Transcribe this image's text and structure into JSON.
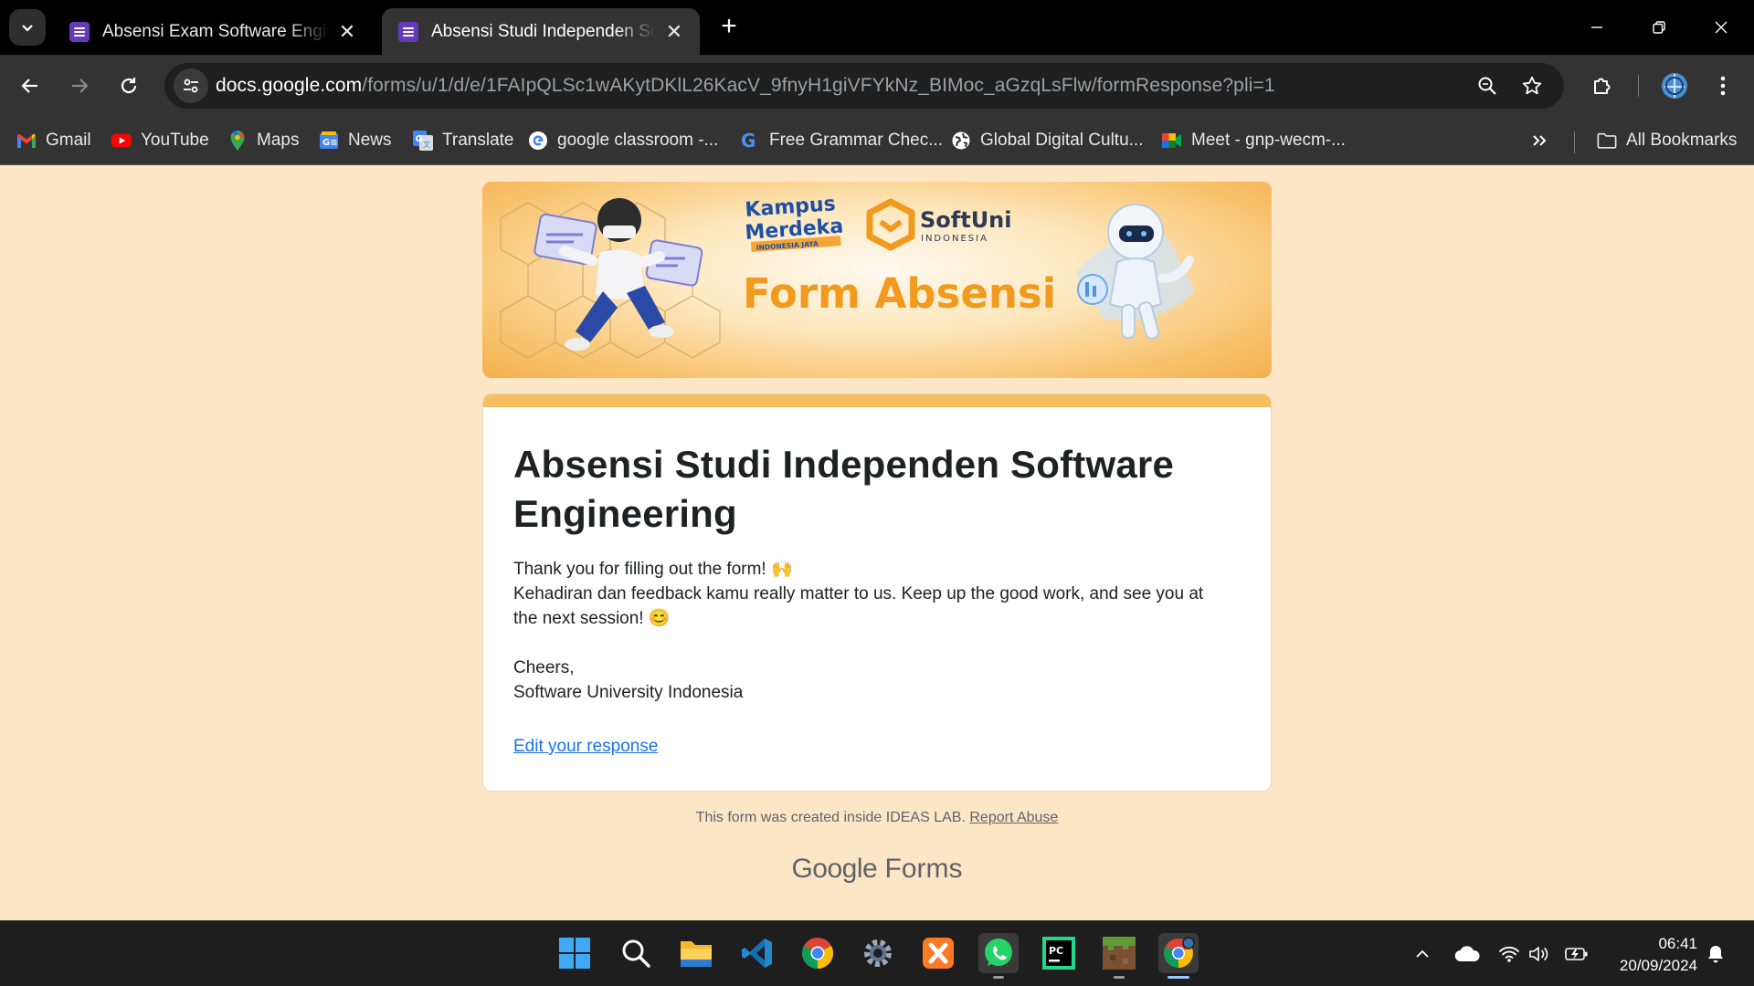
{
  "tabs": [
    {
      "title": "Absensi Exam Software Engineering",
      "active": false
    },
    {
      "title": "Absensi Studi Independen Software Engineering",
      "active": true
    }
  ],
  "new_tab_symbol": "+",
  "address_bar": {
    "host": "docs.google.com",
    "path": "/forms/u/1/d/e/1FAIpQLSc1wAKytDKlL26KacV_9fnyH1giVFYkNz_BIMoc_aGzqLsFlw/formResponse?pli=1"
  },
  "bookmarks": [
    {
      "label": "Gmail",
      "icon": "gmail-icon"
    },
    {
      "label": "YouTube",
      "icon": "youtube-icon"
    },
    {
      "label": "Maps",
      "icon": "maps-icon"
    },
    {
      "label": "News",
      "icon": "news-icon"
    },
    {
      "label": "Translate",
      "icon": "translate-icon"
    },
    {
      "label": "google classroom -...",
      "icon": "google-icon"
    },
    {
      "label": "Free Grammar Chec...",
      "icon": "grammar-icon"
    },
    {
      "label": "Global Digital Cultu...",
      "icon": "globe-icon"
    },
    {
      "label": "Meet - gnp-wecm-...",
      "icon": "meet-icon"
    }
  ],
  "all_bookmarks_label": "All Bookmarks",
  "banner": {
    "brand_line1": "Kampus",
    "brand_line2": "Merdeka",
    "brand_sub": "INDONESIA JAYA",
    "partner": "SoftUni",
    "partner_sub": "INDONESIA",
    "heading": "Form Absensi"
  },
  "form": {
    "title": "Absensi Studi Independen Software Engineering",
    "message_lines": [
      "Thank you for filling out the form! 🙌",
      "Kehadiran dan feedback kamu really matter to us. Keep up the good work, and see you at",
      "the next session! 😊",
      "",
      "Cheers,",
      "Software University Indonesia"
    ],
    "edit_link": "Edit your response"
  },
  "footer": {
    "note": "This form was created inside IDEAS LAB.",
    "report": "Report Abuse",
    "logo_google": "Google",
    "logo_forms": "Forms"
  },
  "taskbar": {
    "apps": [
      "start-icon",
      "search-icon",
      "file-explorer-icon",
      "vscode-icon",
      "chrome-icon",
      "settings-icon",
      "xampp-icon",
      "whatsapp-icon",
      "pycharm-icon",
      "minecraft-icon",
      "chrome-profile-icon"
    ],
    "time": "06:41",
    "date": "20/09/2024"
  },
  "colors": {
    "page_bg": "#fde6c6",
    "accent": "#f6be5e",
    "link": "#1a73e8",
    "forms_purple": "#673ab7"
  }
}
